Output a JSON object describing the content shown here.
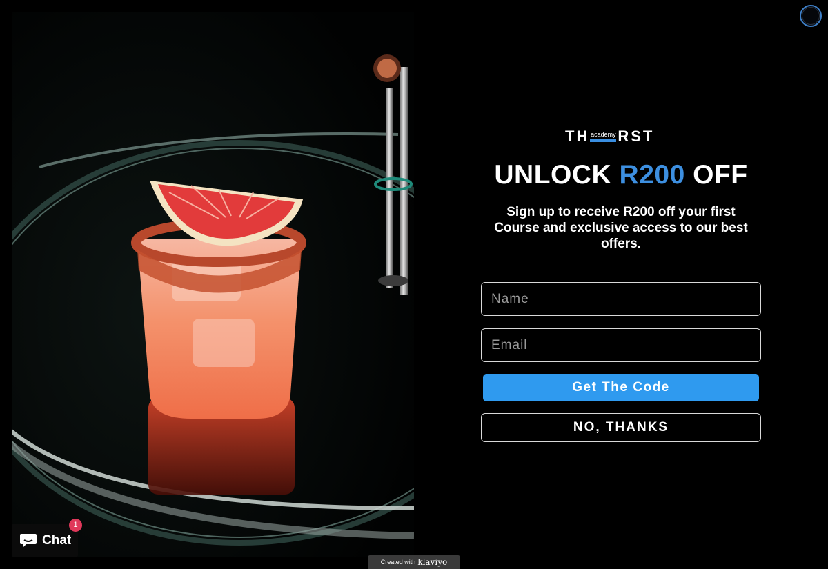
{
  "popup": {
    "logo": {
      "left": "TH",
      "small": "academy",
      "right": "RST"
    },
    "headline": {
      "pre": "UNLOCK ",
      "accent": "R200",
      "post": " OFF"
    },
    "subtext": "Sign up to receive R200 off your first Course and exclusive access to our best offers.",
    "name_placeholder": "Name",
    "email_placeholder": "Email",
    "cta_label": "Get The Code",
    "decline_label": "NO, THANKS",
    "accent_color": "#3d8fe0",
    "cta_color": "#2f9aef"
  },
  "close_icon": "circle-close-icon",
  "chat": {
    "label": "Chat",
    "badge_count": "1",
    "icon": "chat-bubble-icon"
  },
  "attribution": {
    "prefix": "Created with",
    "brand": "klaviyo"
  }
}
